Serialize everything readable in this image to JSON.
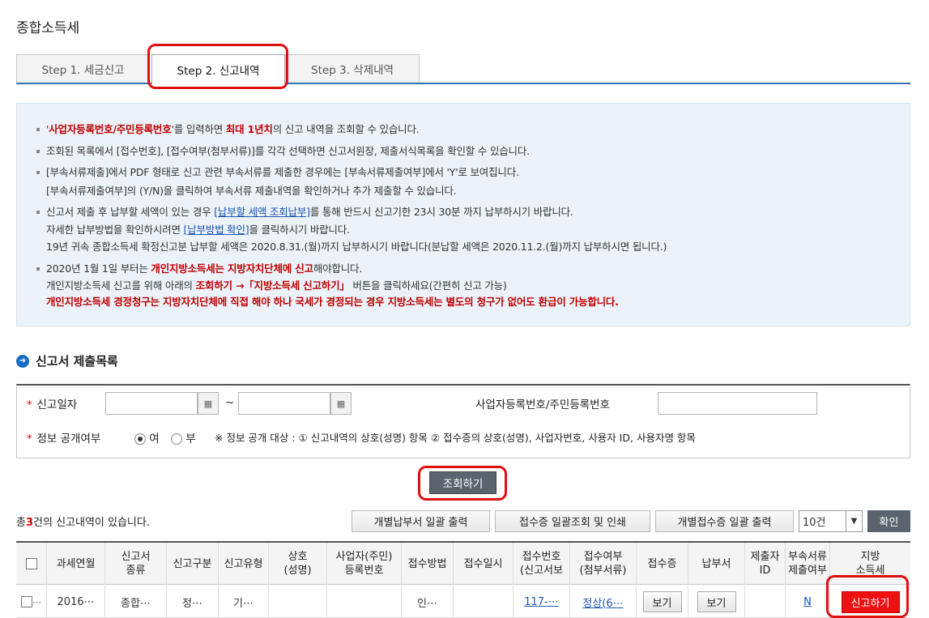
{
  "page_title": "종합소득세",
  "tabs": [
    {
      "label": "Step 1. 세금신고"
    },
    {
      "label": "Step 2. 신고내역"
    },
    {
      "label": "Step 3. 삭제내역"
    }
  ],
  "info": {
    "l1_a": "'",
    "l1_b": "사업자등록번호/주민등록번호",
    "l1_c": "'를 입력하면 ",
    "l1_d": "최대 1년치",
    "l1_e": "의 신고 내역을 조회할 수 있습니다.",
    "l2": "조회된 목록에서 [접수번호], [접수여부(첨부서류)]를 각각 선택하면 신고서원장, 제출서식목록을 확인할 수 있습니다.",
    "l3": "[부속서류제출]에서 PDF 형태로 신고 관련 부속서류를 제출한 경우에는 [부속서류제출여부]에서 'Y'로 보여집니다.",
    "l4": "[부속서류제출여부]의 (Y/N)을 클릭하여 부속서류 제출내역을 확인하거나 추가 제출할 수 있습니다.",
    "l5_a": "신고서 제출 후 납부할 세액이 있는 경우 ",
    "l5_link": "[납부할 세액 조회납부]",
    "l5_b": "를 통해 반드시 신고기한 23시 30분 까지 납부하시기 바랍니다.",
    "l6_a": "자세한 납부방법을 확인하시려면 ",
    "l6_link": "[납부방법 확인]",
    "l6_b": "을 클릭하시기 바랍니다.",
    "l7": "19년 귀속 종합소득세 확정신고분 납부할 세액은 2020.8.31.(월)까지 납부하시기 바랍니다(분납할 세액은 2020.11.2.(월)까지 납부하시면 됩니다.)",
    "l8_a": "2020년 1월 1일 부터는 ",
    "l8_b": "개인지방소득세는 지방자치단체에 신고",
    "l8_c": "해야합니다.",
    "l9_a": "개인지방소득세 신고를 위해 아래의 ",
    "l9_b": "조회하기 →「지방소득세 신고하기」",
    "l9_c": " 버튼을 클릭하세요(간편히 신고 가능)",
    "l10": "개인지방소득세 경정청구는 지방자치단체에 직접 해야 하나 국세가 경정되는 경우 지방소득세는 별도의 청구가 없어도 환급이 가능합니다."
  },
  "section_title": "신고서 제출목록",
  "search": {
    "date_label": "신고일자",
    "date_from": "",
    "date_to": "",
    "tilde": "~",
    "id_label": "사업자등록번호/주민등록번호",
    "id_value": "",
    "public_label": "정보 공개여부",
    "yes_label": "여",
    "no_label": "부",
    "public_selected": "여",
    "note": "※ 정보 공개 대상 : ① 신고내역의 상호(성명) 항목 ② 접수증의 상호(성명), 사업자번호, 사용자 ID, 사용자명 항목"
  },
  "search_button": "조회하기",
  "list": {
    "total_prefix": "총",
    "total_count": "3",
    "total_suffix": "건의 신고내역이 있습니다.",
    "btn_bulk_payment": "개별납부서 일괄 출력",
    "btn_receipt_bulk": "접수증 일괄조회 및 인쇄",
    "btn_receipt_each": "개별접수증 일괄 출력",
    "page_size": "10건",
    "confirm": "확인"
  },
  "table": {
    "headers": [
      "",
      "과세연월",
      "신고서\n종류",
      "신고구분",
      "신고유형",
      "상호\n(성명)",
      "사업자(주민)\n등록번호",
      "접수방법",
      "접수일시",
      "접수번호\n(신고서보",
      "접수여부\n(첨부서류)",
      "접수증",
      "납부서",
      "제출자\nID",
      "부속서류\n제출여부",
      "지방\n소득세"
    ],
    "rows": [
      {
        "period": "2016⋯",
        "form_type": "종합⋯",
        "report_kind": "정⋯",
        "report_type": "기⋯",
        "name": "",
        "reg_no": "",
        "method": "인⋯",
        "datetime": "",
        "receipt_no": "117-⋯",
        "status": "정상(6⋯",
        "receipt_btn": "보기",
        "payment_btn": "보기",
        "submitter_id": "",
        "attach": "N",
        "local_btn": "신고하기"
      }
    ]
  },
  "colors": {
    "accent": "#3a6fb3",
    "highlight_red": "#c00000",
    "annotation": "#e01010"
  }
}
